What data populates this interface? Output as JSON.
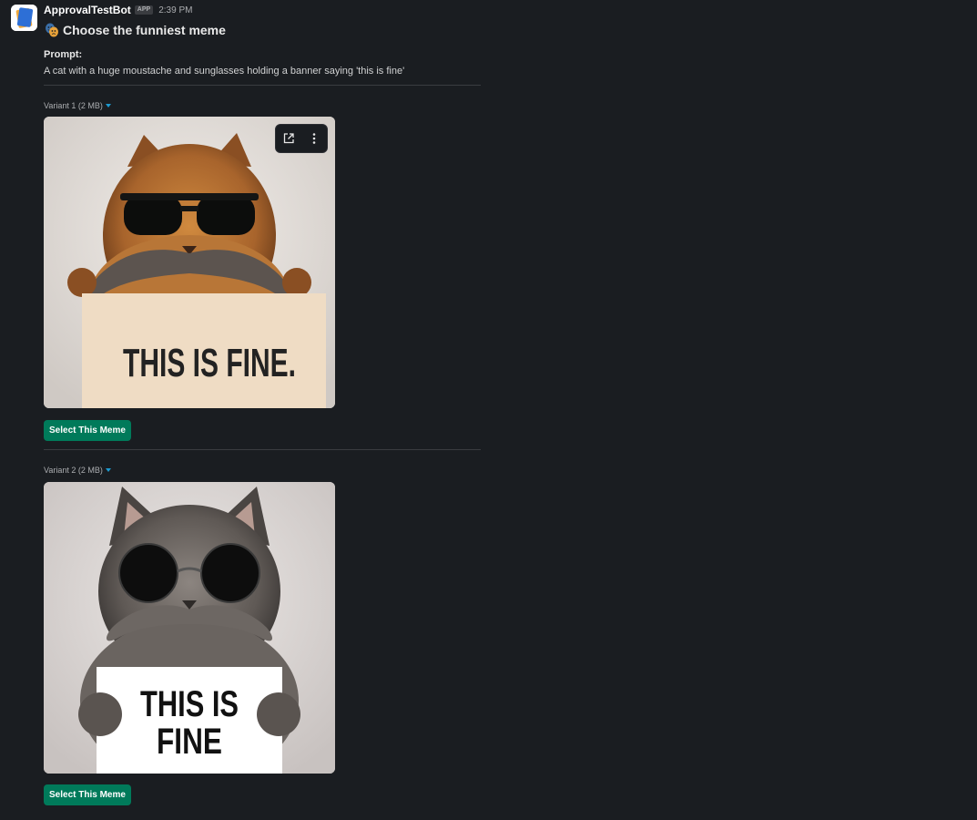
{
  "bot": {
    "name": "ApprovalTestBot",
    "badge": "APP",
    "time": "2:39 PM"
  },
  "message": {
    "title": "Choose the funniest meme",
    "prompt_label": "Prompt:",
    "prompt_text": "A cat with a huge moustache and sunglasses holding a banner saying 'this is fine'"
  },
  "variants": [
    {
      "label": "Variant 1 (2 MB)",
      "sign_lines": [
        "THIS IS FINE."
      ],
      "button": "Select This Meme"
    },
    {
      "label": "Variant 2 (2 MB)",
      "sign_lines": [
        "THIS IS",
        "FINE"
      ],
      "button": "Select This Meme"
    }
  ],
  "image_actions": {
    "open_icon": "open-external-icon",
    "more_icon": "more-vertical-icon"
  },
  "colors": {
    "background": "#1a1d21",
    "button": "#007a5a",
    "accent": "#1d9bd1"
  }
}
